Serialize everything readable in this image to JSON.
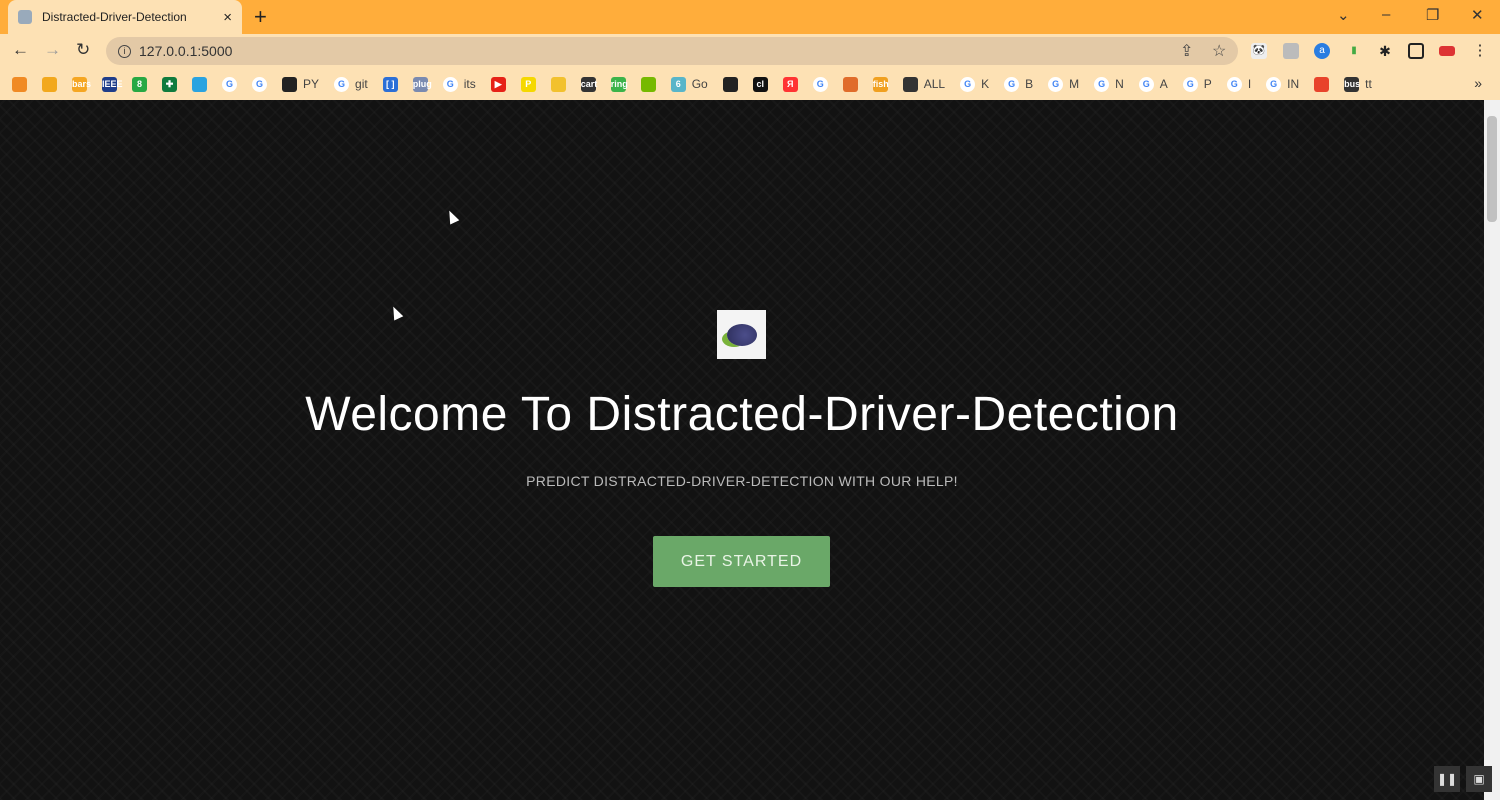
{
  "browser": {
    "tab_title": "Distracted-Driver-Detection",
    "tab_close": "×",
    "new_tab": "+",
    "url": "127.0.0.1:5000",
    "window_controls": {
      "tab_search": "⌄",
      "minimize": "–",
      "restore": "❐",
      "close": "✕"
    },
    "bookmarks": [
      {
        "icon": "orange-diamond",
        "label": "",
        "color": "#f08a24"
      },
      {
        "icon": "yellow-doc",
        "label": "",
        "color": "#f2a81d"
      },
      {
        "icon": "bars",
        "label": "",
        "color": "#f5a623"
      },
      {
        "icon": "IEEE",
        "label": "",
        "color": "#1f3d8a"
      },
      {
        "icon": "8",
        "label": "",
        "color": "#27a844"
      },
      {
        "icon": "✚",
        "label": "",
        "color": "#0f7b3e"
      },
      {
        "icon": "telegram",
        "label": "",
        "color": "#2aa3e0"
      },
      {
        "icon": "G",
        "label": "",
        "color": "#4285f4"
      },
      {
        "icon": "G",
        "label": "",
        "color": "#4285f4"
      },
      {
        "icon": "github",
        "label": "PY",
        "color": "#222"
      },
      {
        "icon": "G",
        "label": "git",
        "color": "#4285f4"
      },
      {
        "icon": "[ ]",
        "label": "",
        "color": "#2c6fd6"
      },
      {
        "icon": "plug",
        "label": "",
        "color": "#7a8ab0"
      },
      {
        "icon": "G",
        "label": "its",
        "color": "#4285f4"
      },
      {
        "icon": "▶",
        "label": "",
        "color": "#e62117"
      },
      {
        "icon": "P",
        "label": "",
        "color": "#f5d800"
      },
      {
        "icon": "camera",
        "label": "",
        "color": "#f2c12e"
      },
      {
        "icon": "cart",
        "label": "",
        "color": "#333"
      },
      {
        "icon": "ring",
        "label": "",
        "color": "#3bb34a"
      },
      {
        "icon": "nvidia",
        "label": "",
        "color": "#76b900"
      },
      {
        "icon": "6",
        "label": "Go",
        "color": "#58b5c9"
      },
      {
        "icon": "penguin",
        "label": "",
        "color": "#222"
      },
      {
        "icon": "cl",
        "label": "",
        "color": "#111"
      },
      {
        "icon": "Я",
        "label": "",
        "color": "#f33"
      },
      {
        "icon": "G",
        "label": "",
        "color": "#4285f4"
      },
      {
        "icon": "matlab",
        "label": "",
        "color": "#e06c2b"
      },
      {
        "icon": "fish",
        "label": "",
        "color": "#f0a020"
      },
      {
        "icon": "globe",
        "label": "ALL",
        "color": "#333"
      },
      {
        "icon": "G",
        "label": "K",
        "color": "#4285f4"
      },
      {
        "icon": "G",
        "label": "B",
        "color": "#4285f4"
      },
      {
        "icon": "G",
        "label": "M",
        "color": "#4285f4"
      },
      {
        "icon": "G",
        "label": "N",
        "color": "#4285f4"
      },
      {
        "icon": "G",
        "label": "A",
        "color": "#4285f4"
      },
      {
        "icon": "G",
        "label": "P",
        "color": "#4285f4"
      },
      {
        "icon": "G",
        "label": "I",
        "color": "#4285f4"
      },
      {
        "icon": "G",
        "label": "IN",
        "color": "#4285f4"
      },
      {
        "icon": "office",
        "label": "",
        "color": "#e8432b"
      },
      {
        "icon": "bus",
        "label": "tt",
        "color": "#333"
      }
    ],
    "more_bookmarks": "»"
  },
  "page": {
    "heading": "Welcome To Distracted-Driver-Detection",
    "subheading": "PREDICT DISTRACTED-DRIVER-DETECTION WITH OUR HELP!",
    "cta_label": "GET STARTED",
    "cta_color": "#6aa868"
  },
  "media_controls": {
    "pause": "❚❚",
    "pip": "▣"
  }
}
